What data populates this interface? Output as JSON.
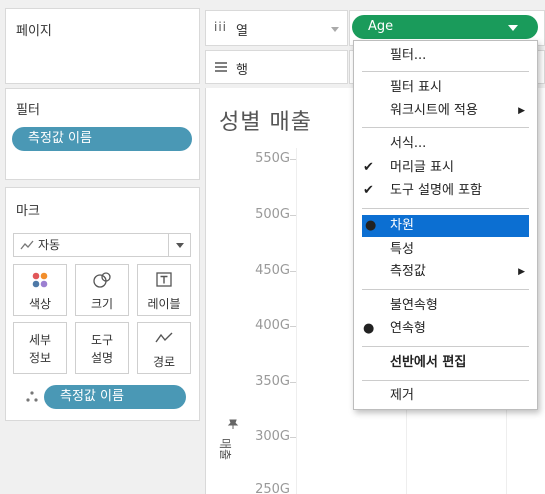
{
  "left": {
    "pages_title": "페이지",
    "filters_title": "필터",
    "filter_pill": "측정값 이름",
    "marks_title": "마크",
    "mark_type": "자동",
    "mark_buttons": {
      "color": "색상",
      "size": "크기",
      "label": "레이블",
      "detail_line1": "세부",
      "detail_line2": "정보",
      "tooltip_line1": "도구",
      "tooltip_line2": "설명",
      "path": "경로"
    },
    "marks_pill": "측정값 이름"
  },
  "shelves": {
    "columns_label": "열",
    "rows_label": "행",
    "columns_pill": "Age"
  },
  "view": {
    "title": "성별 매출",
    "y_ticks": [
      "550G",
      "500G",
      "450G",
      "400G",
      "350G",
      "300G",
      "250G"
    ],
    "y_axis_label": "매출"
  },
  "context_menu": {
    "filter": "필터...",
    "show_filter": "필터 표시",
    "apply_to_worksheets": "워크시트에 적용",
    "format": "서식...",
    "show_header": "머리글 표시",
    "include_in_tooltip": "도구 설명에 포함",
    "dimension": "차원",
    "attribute": "특성",
    "measure": "측정값",
    "discrete": "불연속형",
    "continuous": "연속형",
    "edit_in_shelf": "선반에서 편집",
    "remove": "제거"
  },
  "colors": {
    "pill_blue": "#4a98b5",
    "pill_green": "#1a9b5b",
    "menu_selected": "#0c6fd2"
  }
}
